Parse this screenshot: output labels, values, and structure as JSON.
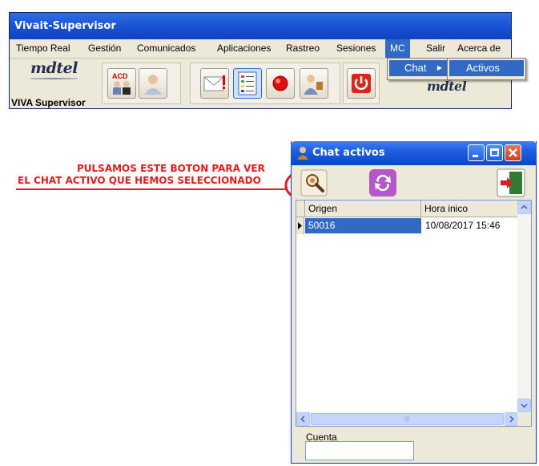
{
  "main_window": {
    "title": "Vivait-Supervisor",
    "menu": [
      "Tiempo Real",
      "Gestión",
      "Comunicados",
      "Aplicaciones",
      "Rastreo",
      "Sesiones",
      "MC",
      "Salir",
      "Acerca de"
    ],
    "active_menu": "MC",
    "submenu_item": "Chat",
    "submenu_arrow": "▶",
    "subsubmenu_item": "Activos",
    "logo_text": "mdtel",
    "logo_text_2": "mdtel",
    "viva_label": "VIVA Supervisor",
    "acd_label": "ACD",
    "toolbar_icons": [
      "acd-agents-icon",
      "user-icon",
      "envelope-icon",
      "report-list-icon",
      "record-icon",
      "user-speaker-icon",
      "power-icon"
    ]
  },
  "annotation": {
    "line1": "PULSAMOS ESTE BOTON PARA VER",
    "line2": "EL CHAT ACTIVO QUE HEMOS SELECCIONADO",
    "color": "#e51c1c"
  },
  "chat_window": {
    "title": "Chat activos",
    "tools": [
      "magnifier-icon",
      "refresh-icon",
      "exit-door-icon"
    ],
    "columns": [
      "Origen",
      "Hora inico"
    ],
    "rows": [
      {
        "origen": "50016",
        "hora": "10/08/2017 15:46"
      }
    ],
    "hscroll_grip": "|||",
    "cuenta_label": "Cuenta",
    "cuenta_value": ""
  },
  "colors": {
    "title_blue": "#1a55d6",
    "selection": "#316ac5",
    "face": "#ece9d8"
  }
}
